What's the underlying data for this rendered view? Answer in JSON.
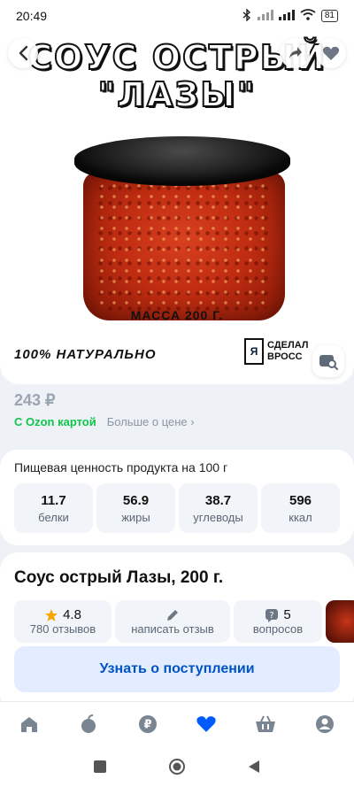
{
  "status_bar": {
    "time": "20:49",
    "battery": "81"
  },
  "hero": {
    "title_line1": "СОУС ОСТРЫЙ",
    "title_line2": "\"ЛАЗЫ\"",
    "mass_label": "МАССА 200 Г.",
    "natural_label": "100% НАТУРАЛЬНО",
    "maker_letter": "Я",
    "maker_line1": "СДЕЛАЛ",
    "maker_line2": "ВРОСС"
  },
  "price": {
    "amount": "243 ₽",
    "ozon_card": "С Ozon картой",
    "more_price": "Больше о цене ›"
  },
  "nutrition": {
    "title": "Пищевая ценность продукта на 100 г",
    "cells": [
      {
        "value": "11.7",
        "label": "белки"
      },
      {
        "value": "56.9",
        "label": "жиры"
      },
      {
        "value": "38.7",
        "label": "углеводы"
      },
      {
        "value": "596",
        "label": "ккал"
      }
    ]
  },
  "product": {
    "title": "Соус острый Лазы, 200 г.",
    "rating_value": "4.8",
    "reviews_count": "780 отзывов",
    "write_review": "написать отзыв",
    "questions_count": "5",
    "questions_label": "вопросов"
  },
  "notify_button": "Узнать о поступлении",
  "colors": {
    "accent": "#0053c7",
    "ozon_green": "#10c44c",
    "favorite": "#005bff"
  },
  "tabs": [
    "home-icon",
    "fresh-icon",
    "points-icon",
    "favorites-icon",
    "cart-icon",
    "profile-icon"
  ]
}
